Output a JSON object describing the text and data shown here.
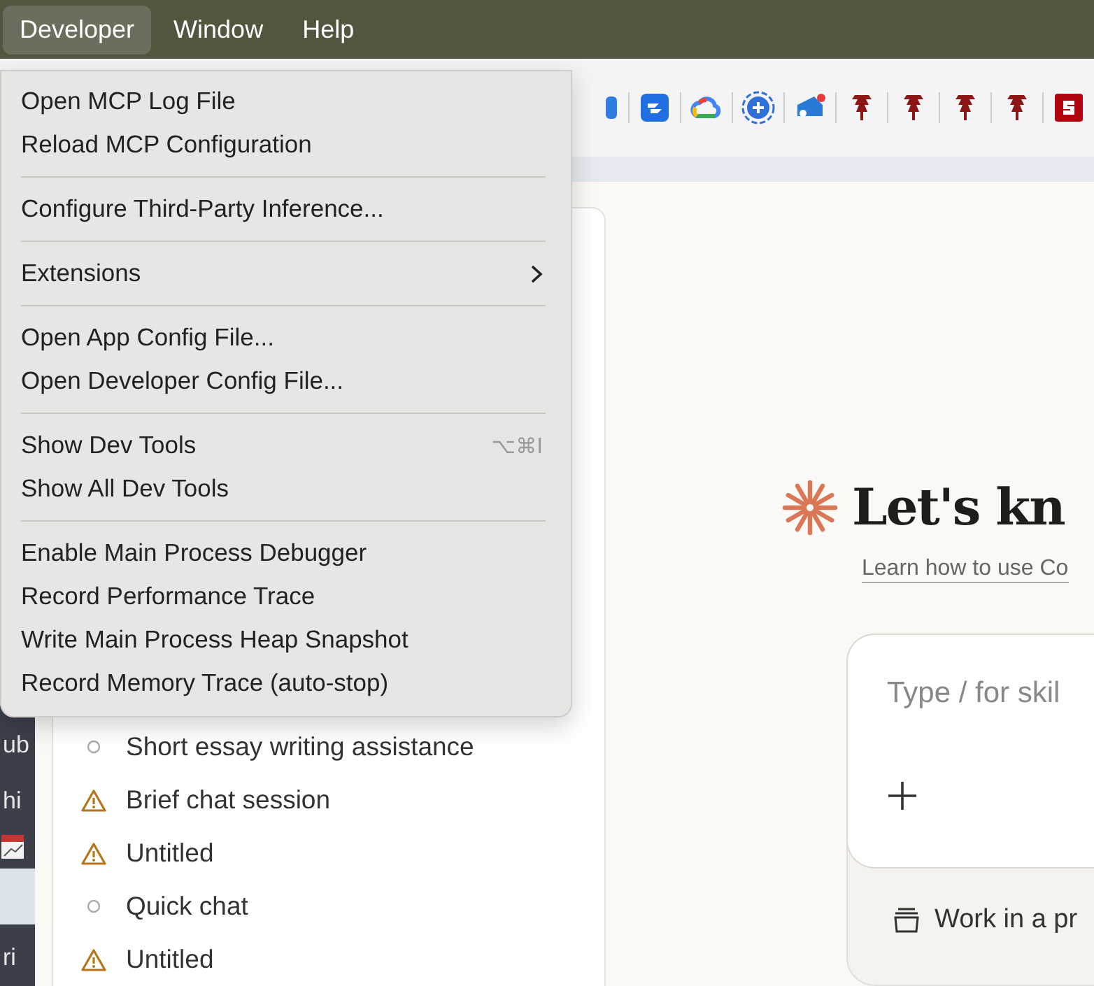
{
  "menu_bar": [
    {
      "label": "Developer",
      "selected": true
    },
    {
      "label": "Window",
      "selected": false
    },
    {
      "label": "Help",
      "selected": false
    }
  ],
  "desktop_fragments": [
    "ub",
    "hi",
    "ri"
  ],
  "recents": [
    {
      "kind": "circle",
      "title": "Short essay writing assistance"
    },
    {
      "kind": "warning",
      "title": "Brief chat session"
    },
    {
      "kind": "warning",
      "title": "Untitled"
    },
    {
      "kind": "circle",
      "title": "Quick chat"
    },
    {
      "kind": "warning",
      "title": "Untitled"
    }
  ],
  "main": {
    "heading": "Let's kn",
    "learn_link": "Learn how to use Co",
    "composer": {
      "placeholder": "Type / for skil"
    },
    "project_row": "Work in a pr"
  },
  "developer_menu": [
    [
      {
        "label": "Open MCP Log File"
      },
      {
        "label": "Reload MCP Configuration"
      }
    ],
    [
      {
        "label": "Configure Third-Party Inference..."
      }
    ],
    [
      {
        "label": "Extensions",
        "submenu": true
      }
    ],
    [
      {
        "label": "Open App Config File..."
      },
      {
        "label": "Open Developer Config File..."
      }
    ],
    [
      {
        "label": "Show Dev Tools",
        "shortcut": "⌥⌘I"
      },
      {
        "label": "Show All Dev Tools"
      }
    ],
    [
      {
        "label": "Enable Main Process Debugger"
      },
      {
        "label": "Record Performance Trace"
      },
      {
        "label": "Write Main Process Heap Snapshot"
      },
      {
        "label": "Record Memory Trace (auto-stop)"
      }
    ]
  ]
}
